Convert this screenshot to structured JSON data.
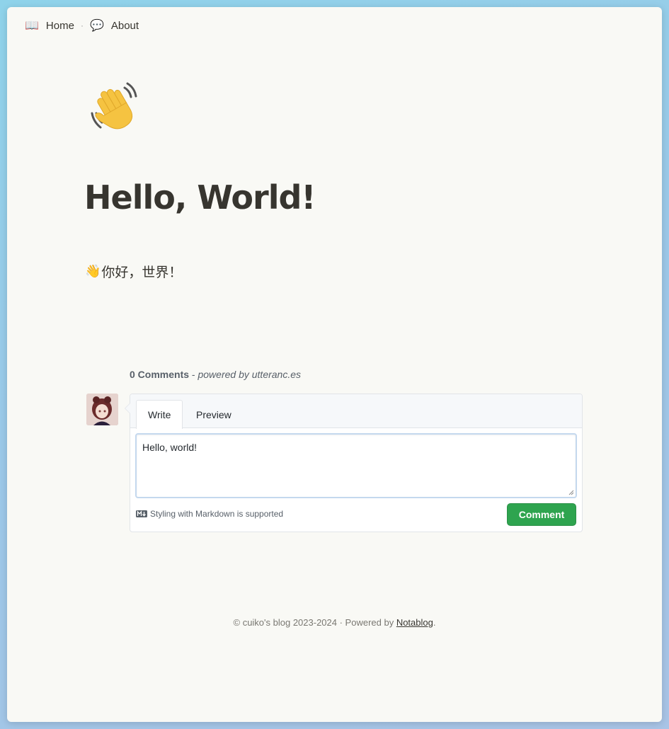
{
  "nav": {
    "home_emoji": "📖",
    "home_label": "Home",
    "separator": "·",
    "about_emoji": "💬",
    "about_label": "About"
  },
  "page": {
    "icon": "waving-hand-emoji",
    "title": "Hello, World!",
    "paragraph_emoji": "👋",
    "paragraph_text": "你好，世界！"
  },
  "comments": {
    "count_label": "0 Comments",
    "separator": " - ",
    "powered_label": "powered by utteranc.es",
    "tabs": [
      {
        "label": "Write",
        "active": true
      },
      {
        "label": "Preview",
        "active": false
      }
    ],
    "input_value": "Hello, world!",
    "markdown_note": "Styling with Markdown is supported",
    "submit_label": "Comment",
    "submit_color": "#2ea44f"
  },
  "footer": {
    "prefix": "© cuiko's blog 2023-2024 · Powered by ",
    "link_label": "Notablog",
    "suffix": "."
  }
}
